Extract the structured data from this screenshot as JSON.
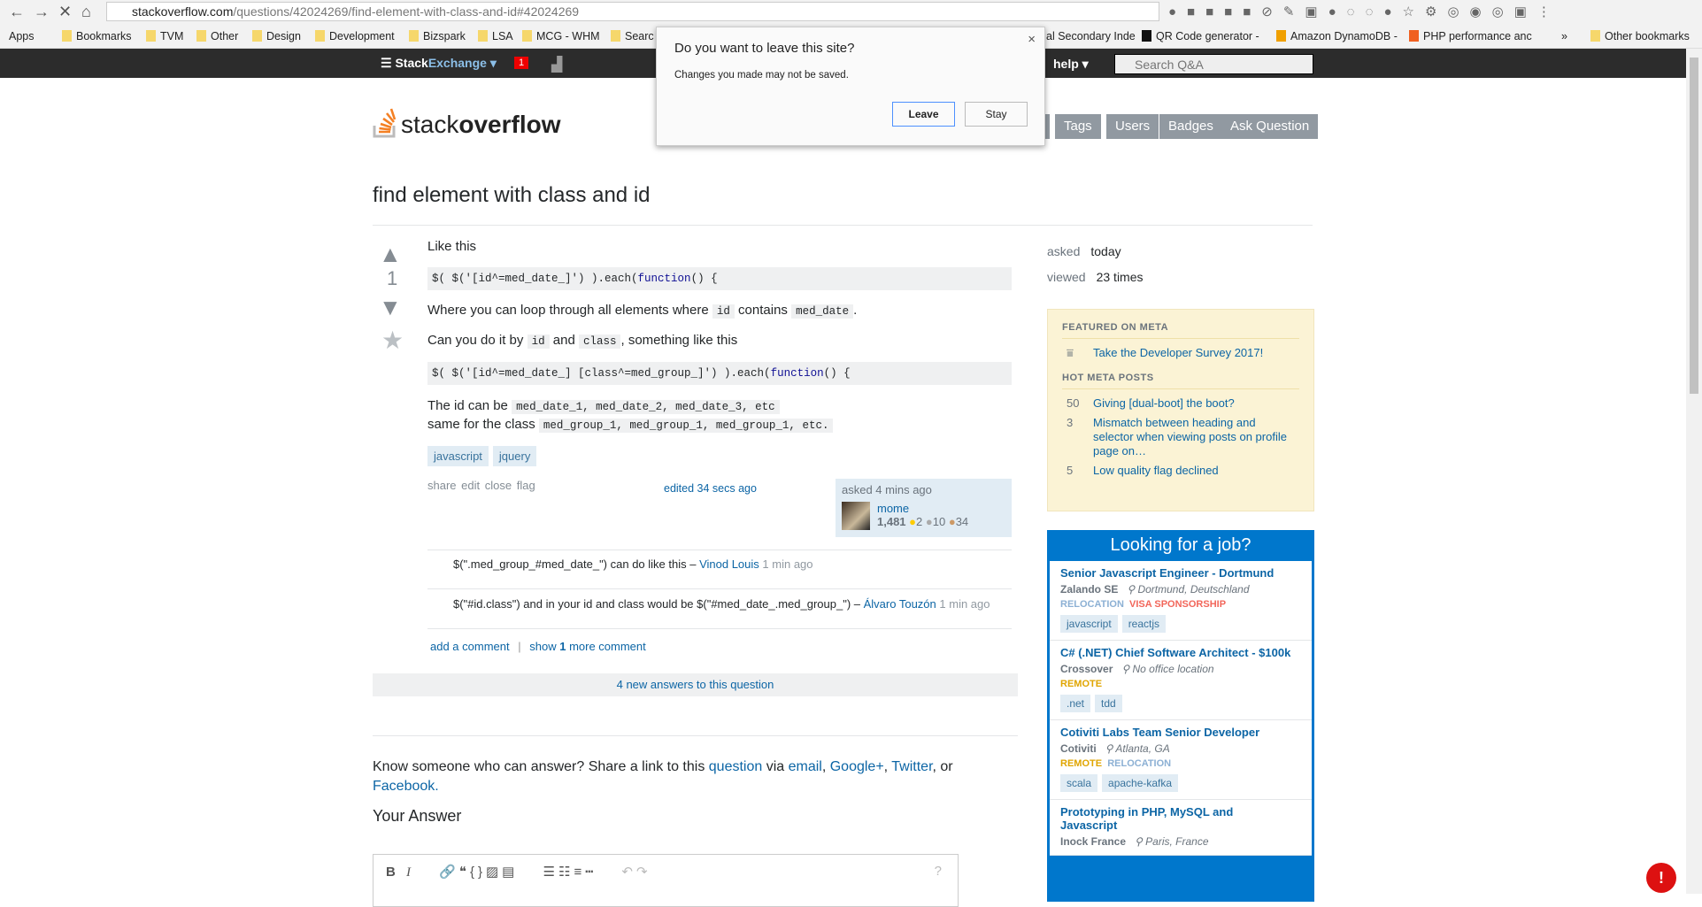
{
  "browser": {
    "url_host": "stackoverflow.com",
    "url_path": "/questions/42024269/find-element-with-class-and-id#42024269",
    "bookmarks": [
      "Apps",
      "Bookmarks",
      "TVM",
      "Other",
      "Design",
      "Development",
      "Bizspark",
      "LSA",
      "MCG - WHM",
      "Searc",
      "al Secondary Inde",
      "QR Code generator -",
      "Amazon DynamoDB -",
      "PHP performance anc",
      "»",
      "Other bookmarks"
    ]
  },
  "topbar": {
    "brand_a": "Stack",
    "brand_b": "Exchange ▾",
    "notifications": "1",
    "help": "help ▾",
    "search_placeholder": "Search Q&A"
  },
  "logo": {
    "a": "stack",
    "b": "overflow"
  },
  "nav": [
    "Tags",
    "Users",
    "Badges",
    "Ask Question"
  ],
  "question": {
    "title": "find element with class and id",
    "votes": "1",
    "p1": "Like this",
    "code1a": "$( $('[id^=med_date_]') ).each(",
    "code1kw": "function",
    "code1b": "() {",
    "p2a": "Where you can loop through all elements where ",
    "p2c1": "id",
    "p2b": " contains ",
    "p2c2": "med_date",
    "p2d": ".",
    "p3a": "Can you do it by ",
    "p3c1": "id",
    "p3b": " and ",
    "p3c2": "class",
    "p3d": ", something like this",
    "code2a": "$( $('[id^=med_date_] [class^=med_group_]') ).each(",
    "code2kw": "function",
    "code2b": "() {",
    "p4a": "The id can be ",
    "p4c": "med_date_1, med_date_2, med_date_3, etc",
    "p5a": "same for the class ",
    "p5c": "med_group_1, med_group_1, med_group_1, etc.",
    "tags": [
      "javascript",
      "jquery"
    ],
    "actions": [
      "share",
      "edit",
      "close",
      "flag"
    ],
    "edited": "edited 34 secs ago",
    "asked": "asked 4 mins ago",
    "user": "mome",
    "rep": "1,481",
    "gold": "2",
    "silver": "10",
    "bronze": "34"
  },
  "comments": [
    {
      "text": "$(\".med_group_#med_date_\") can do like this – ",
      "user": "Vinod Louis",
      "time": "1 min ago"
    },
    {
      "text": "$(\"#id.class\") and in your id and class would be $(\"#med_date_.med_group_\") – ",
      "user": "Álvaro Touzón",
      "time": "1 min ago"
    }
  ],
  "comment_links": {
    "add": "add a comment",
    "sep": "|",
    "show": "show ",
    "count": "1",
    "more": " more comment"
  },
  "new_answers": "4 new answers to this question",
  "share": {
    "a": "Know someone who can answer? Share a link to this ",
    "q": "question",
    "via": " via ",
    "email": "email",
    "c": ", ",
    "gp": "Google+",
    "tw": "Twitter",
    "or": ", or ",
    "fb": "Facebook",
    "end": "."
  },
  "your_answer": "Your Answer",
  "editor_tools": [
    "bold-icon",
    "italic-icon",
    "link-icon",
    "quote-icon",
    "code-icon",
    "image-icon",
    "snippet-icon",
    "ordered-list-icon",
    "bullet-list-icon",
    "heading-icon",
    "hr-icon",
    "undo-icon",
    "redo-icon",
    "help-icon"
  ],
  "sidebar": {
    "asked_label": "asked",
    "asked_val": "today",
    "viewed_label": "viewed",
    "viewed_val": "23 times",
    "featured_h": "FEATURED ON META",
    "featured": "Take the Developer Survey 2017!",
    "hot_h": "HOT META POSTS",
    "hot": [
      {
        "n": "50",
        "t": "Giving [dual-boot] the boot?"
      },
      {
        "n": "3",
        "t": "Mismatch between heading and selector when viewing posts on profile page on…"
      },
      {
        "n": "5",
        "t": "Low quality flag declined"
      }
    ],
    "jobs_h": "Looking for a job?",
    "jobs": [
      {
        "title": "Senior Javascript Engineer - Dortmund",
        "company": "Zalando SE",
        "loc": "Dortmund, Deutschland",
        "perks": [
          "RELOCATION",
          "VISA SPONSORSHIP"
        ],
        "tags": [
          "javascript",
          "reactjs"
        ]
      },
      {
        "title": "C# (.NET) Chief Software Architect - $100k",
        "company": "Crossover",
        "loc": "No office location",
        "perks": [
          "REMOTE"
        ],
        "tags": [
          ".net",
          "tdd"
        ]
      },
      {
        "title": "Cotiviti Labs Team Senior Developer",
        "company": "Cotiviti",
        "loc": "Atlanta, GA",
        "perks": [
          "REMOTE",
          "RELOCATION"
        ],
        "tags": [
          "scala",
          "apache-kafka"
        ]
      },
      {
        "title": "Prototyping in PHP, MySQL and Javascript",
        "company": "Inock France",
        "loc": "Paris, France",
        "perks": [],
        "tags": []
      }
    ]
  },
  "dialog": {
    "title": "Do you want to leave this site?",
    "message": "Changes you made may not be saved.",
    "leave": "Leave",
    "stay": "Stay",
    "close": "×"
  },
  "colors": {
    "link": "#0c65a5",
    "topbar": "#2c2c2c",
    "jobs": "#0077cc",
    "meta_bg": "#fbf3d5"
  }
}
